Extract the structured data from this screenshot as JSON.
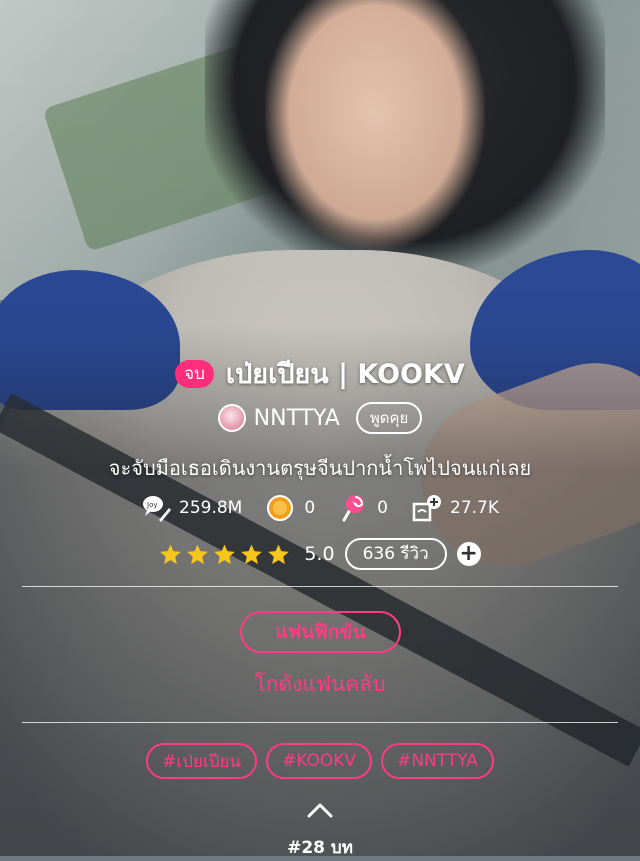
{
  "story": {
    "status_badge": "จบ",
    "title": "เป่ยเปียน | KOOKV",
    "author": "NNTTYA",
    "chat_label": "พูดคุย",
    "tagline": "จะจับมือเธอเดินงานตรุษจีนปากน้ำโพไปจนแก่เลย"
  },
  "stats": {
    "views": "259.8M",
    "coins": "0",
    "candies": "0",
    "library_adds": "27.7K"
  },
  "rating": {
    "value": "5.0",
    "stars": 5,
    "reviews_label": "636 รีวิว"
  },
  "actions": {
    "fan_button": "แฟนฟิกขัน",
    "fanclub_link": "โกดังแฟนคลับ"
  },
  "tags": [
    "#เป่ยเปียน",
    "#KOOKV",
    "#NNTTYA"
  ],
  "episodes": "#28 บท",
  "colors": {
    "accent_pink": "#ff3c82",
    "badge_pink": "#ff2d7a",
    "star_yellow": "#f6c61a"
  }
}
